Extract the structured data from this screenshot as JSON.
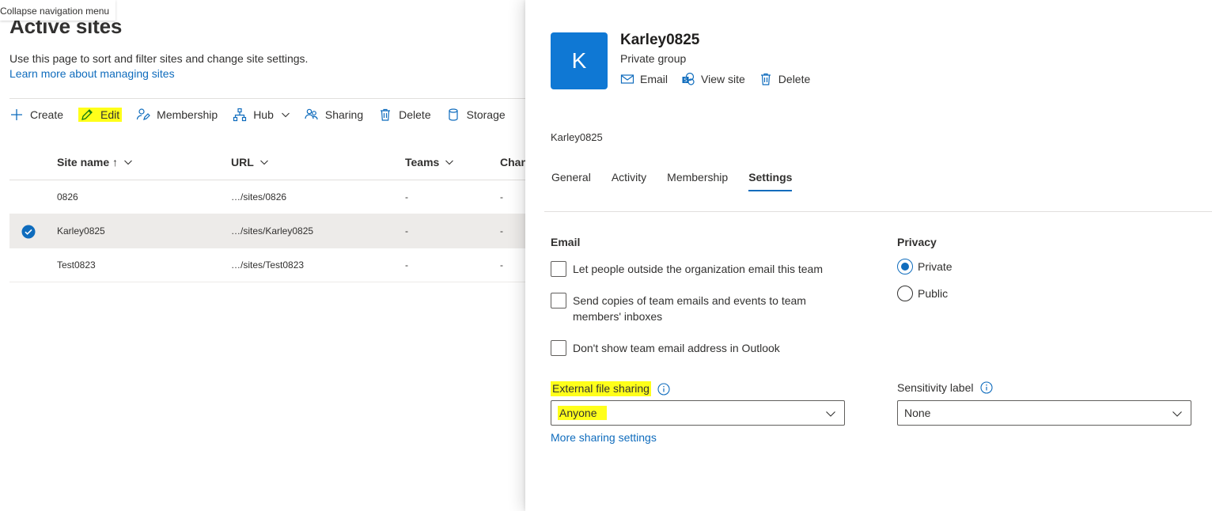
{
  "tooltip": "Collapse navigation menu",
  "page": {
    "title": "Active sites",
    "description": "Use this page to sort and filter sites and change site settings.",
    "learn_more": "Learn more about managing sites"
  },
  "commands": {
    "create": "Create",
    "edit": "Edit",
    "membership": "Membership",
    "hub": "Hub",
    "sharing": "Sharing",
    "delete": "Delete",
    "storage": "Storage"
  },
  "table": {
    "columns": {
      "site_name": "Site name ↑",
      "url": "URL",
      "teams": "Teams",
      "channels": "Chan"
    },
    "rows": [
      {
        "name": "0826",
        "url": "…/sites/0826",
        "teams": "-",
        "channels": "-"
      },
      {
        "name": "Karley0825",
        "url": "…/sites/Karley0825",
        "teams": "-",
        "channels": "-"
      },
      {
        "name": "Test0823",
        "url": "…/sites/Test0823",
        "teams": "-",
        "channels": "-"
      }
    ]
  },
  "panel": {
    "avatar_letter": "K",
    "group_name": "Karley0825",
    "group_type": "Private group",
    "actions": {
      "email": "Email",
      "view_site": "View site",
      "delete": "Delete"
    },
    "sub_name": "Karley0825",
    "tabs": [
      "General",
      "Activity",
      "Membership",
      "Settings"
    ],
    "active_tab": "Settings",
    "email": {
      "label": "Email",
      "options": [
        "Let people outside the organization email this team",
        "Send copies of team emails and events to team members' inboxes",
        "Don't show team email address in Outlook"
      ]
    },
    "privacy": {
      "label": "Privacy",
      "options": [
        "Private",
        "Public"
      ],
      "selected": "Private"
    },
    "external_sharing": {
      "label": "External file sharing",
      "value": "Anyone",
      "more_link": "More sharing settings"
    },
    "sensitivity": {
      "label": "Sensitivity label",
      "value": "None"
    }
  },
  "colors": {
    "accent": "#0f6cbd",
    "avatar": "#0f78d4",
    "highlight": "#ffff1a"
  }
}
